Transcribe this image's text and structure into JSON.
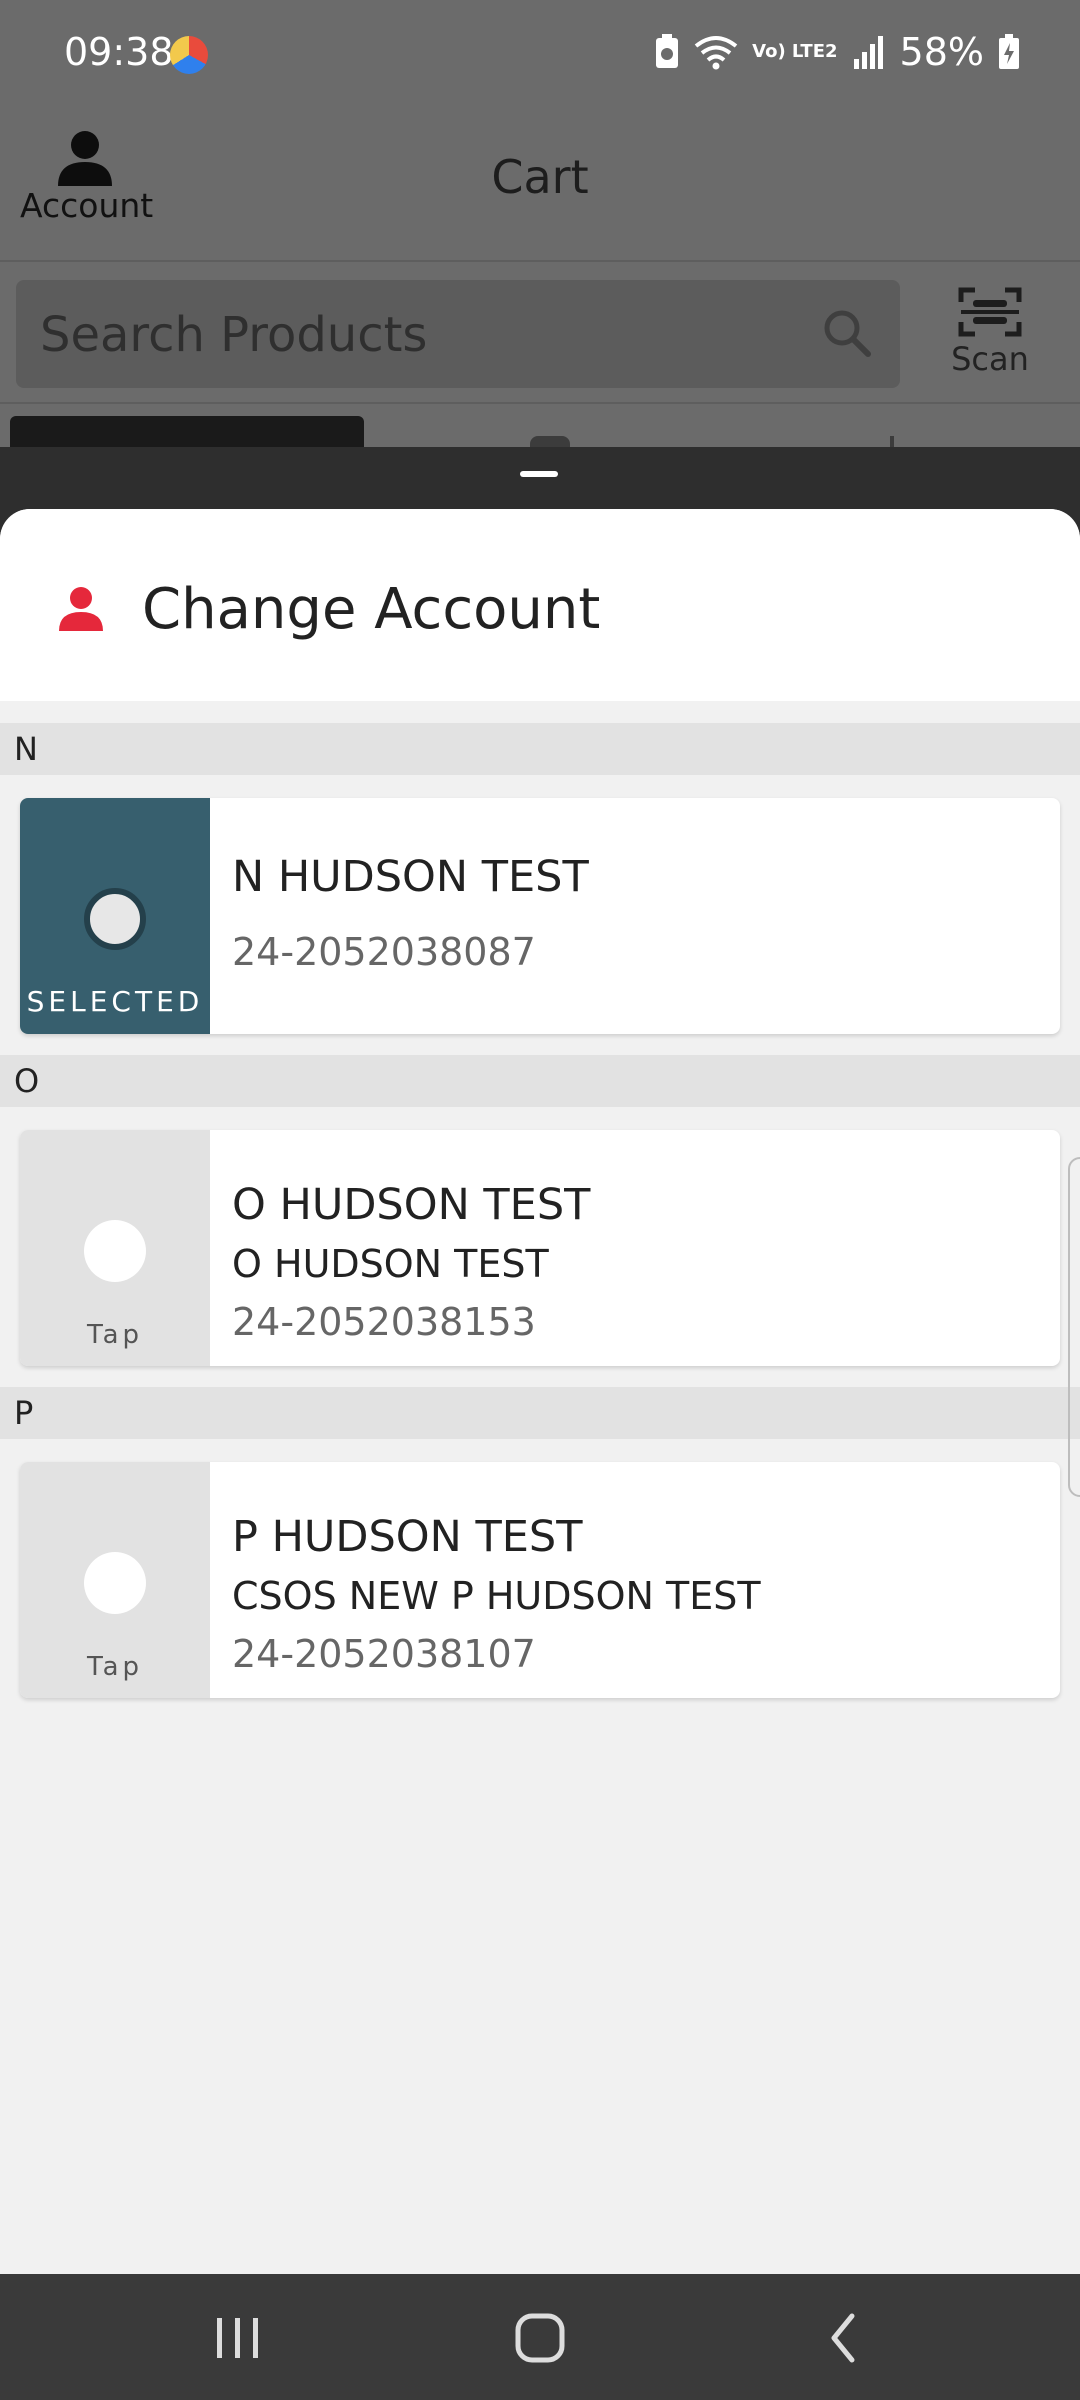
{
  "status_bar": {
    "time": "09:38",
    "network": "Vo) LTE2",
    "battery": "58%"
  },
  "header": {
    "account_label": "Account",
    "title": "Cart",
    "scan_label": "Scan"
  },
  "search": {
    "placeholder": "Search Products"
  },
  "sheet": {
    "title": "Change Account",
    "accent_color": "#e5283b",
    "selected_color": "#375f6e",
    "sections": [
      {
        "letter": "N",
        "account": {
          "name": "N HUDSON TEST",
          "subtitle": "",
          "number": "24-2052038087",
          "selected": true,
          "selector_label": "SELECTED"
        }
      },
      {
        "letter": "O",
        "account": {
          "name": "O HUDSON TEST",
          "subtitle": "O HUDSON TEST",
          "number": "24-2052038153",
          "selected": false,
          "selector_label": "Tap"
        }
      },
      {
        "letter": "P",
        "account": {
          "name": "P HUDSON TEST",
          "subtitle": "CSOS NEW P HUDSON TEST",
          "number": "24-2052038107",
          "selected": false,
          "selector_label": "Tap"
        }
      }
    ]
  },
  "nav": {
    "icons": [
      "recents-icon",
      "home-icon",
      "back-icon"
    ]
  }
}
